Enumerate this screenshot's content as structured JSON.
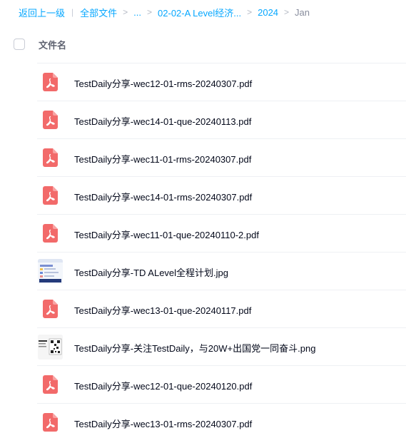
{
  "breadcrumb": {
    "back": "返回上一级",
    "separator": "|",
    "root": "全部文件",
    "ellipsis": "...",
    "folder": "02-02-A Level经济...",
    "year": "2024",
    "current": "Jan",
    "arrow": ">"
  },
  "list_header": {
    "name_label": "文件名"
  },
  "files": [
    {
      "name": "TestDaily分享-wec12-01-rms-20240307.pdf",
      "type": "pdf"
    },
    {
      "name": "TestDaily分享-wec14-01-que-20240113.pdf",
      "type": "pdf"
    },
    {
      "name": "TestDaily分享-wec11-01-rms-20240307.pdf",
      "type": "pdf"
    },
    {
      "name": "TestDaily分享-wec14-01-rms-20240307.pdf",
      "type": "pdf"
    },
    {
      "name": "TestDaily分享-wec11-01-que-20240110-2.pdf",
      "type": "pdf"
    },
    {
      "name": "TestDaily分享-TD ALevel全程计划.jpg",
      "type": "jpg"
    },
    {
      "name": "TestDaily分享-wec13-01-que-20240117.pdf",
      "type": "pdf"
    },
    {
      "name": "TestDaily分享-关注TestDaily，与20W+出国党一同奋斗.png",
      "type": "png"
    },
    {
      "name": "TestDaily分享-wec12-01-que-20240120.pdf",
      "type": "pdf"
    },
    {
      "name": "TestDaily分享-wec13-01-rms-20240307.pdf",
      "type": "pdf"
    }
  ],
  "colors": {
    "link": "#06a7ff",
    "pdf_icon": "#f26a6a",
    "text": "#03081a"
  }
}
